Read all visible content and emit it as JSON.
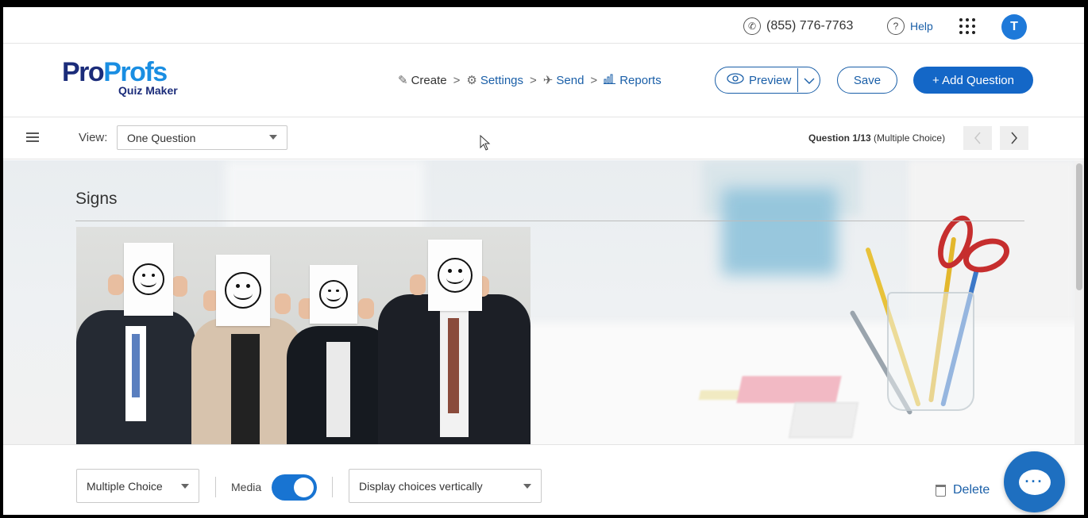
{
  "topbar": {
    "phone_icon": "phone-icon",
    "phone": "(855) 776-7763",
    "help_icon": "question-circle-icon",
    "help": "Help",
    "apps_icon": "grid-apps-icon",
    "avatar_initial": "T",
    "avatar_color": "#1e79d9"
  },
  "header": {
    "logo_pro": "Pro",
    "logo_profs": "Profs",
    "logo_sub": "Quiz Maker",
    "steps": [
      {
        "label": "Create",
        "icon": "pencil-icon"
      },
      {
        "label": "Settings",
        "icon": "gear-icon"
      },
      {
        "label": "Send",
        "icon": "paper-plane-icon"
      },
      {
        "label": "Reports",
        "icon": "bar-chart-icon"
      }
    ],
    "step_separator": ">",
    "preview_label": "Preview",
    "save_label": "Save",
    "add_question_label": "+ Add Question",
    "accent_color": "#1467c7"
  },
  "toolbar": {
    "view_label": "View:",
    "view_value": "One Question",
    "question_bold": "Question 1/13",
    "question_type": "(Multiple Choice)"
  },
  "question": {
    "title": "Signs"
  },
  "bottom": {
    "type_value": "Multiple Choice",
    "media_label": "Media",
    "media_on": true,
    "display_value": "Display choices vertically",
    "delete_label": "Delete"
  },
  "chat": {
    "icon": "chat-bubble-icon"
  }
}
